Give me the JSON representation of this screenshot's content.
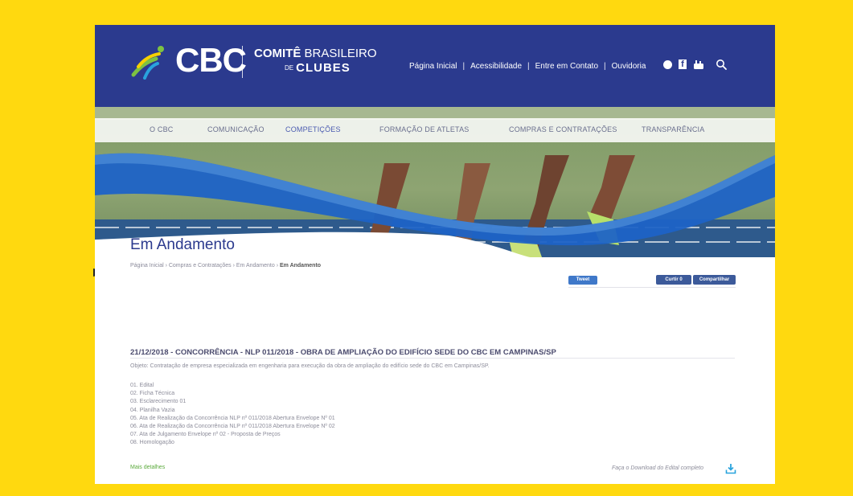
{
  "site": {
    "logo_abbr": "CBC",
    "logo_line1_a": "COMITÊ",
    "logo_line1_b": "BRASILEIRO",
    "logo_line2_a": "DE",
    "logo_line2_b": "CLUBES"
  },
  "header_links": [
    "Página Inicial",
    "Acessibilidade",
    "Entre em Contato",
    "Ouvidoria"
  ],
  "social_icons": [
    "circle-icon",
    "facebook-icon",
    "youtube-icon",
    "search-icon"
  ],
  "nav": [
    "O CBC",
    "COMUNICAÇÃO",
    "COMPETIÇÕES",
    "FORMAÇÃO DE ATLETAS",
    "COMPRAS E CONTRATAÇÕES",
    "TRANSPARÊNCIA"
  ],
  "nav_active_index": 2,
  "page": {
    "title": "Em Andamento",
    "breadcrumb": "Página Inicial › Compras e Contratações › Em Andamento › ",
    "breadcrumb_current": "Em Andamento"
  },
  "share": {
    "tweet": "Tweet",
    "curtir": "Curtir 0",
    "compartilhar": "Compartilhar"
  },
  "article": {
    "title": "21/12/2018 - CONCORRÊNCIA - NLP 011/2018 - OBRA DE AMPLIAÇÃO DO EDIFÍCIO SEDE DO CBC EM CAMPINAS/SP",
    "description": "Objeto: Contratação de empresa especializada em engenharia para execução da obra de ampliação do edifício sede do CBC em Campinas/SP.",
    "documents": [
      "01. Edital",
      "02. Ficha Técnica",
      "03. Esclarecimento 01",
      "04. Planilha Vazia",
      "05. Ata de Realização da Concorrência NLP nº 011/2018 Abertura Envelope Nº 01",
      "06. Ata de Realização da Concorrência NLP nº 011/2018 Abertura Envelope Nº 02",
      "07. Ata de Julgamento Envelope nº 02 - Proposta de Preços",
      "08. Homologação"
    ],
    "more_link": "Mais detalhes",
    "download_label": "Faça o Download do Edital completo"
  },
  "colors": {
    "background": "#FFD90F",
    "header": "#2B3A8E",
    "accent_blue": "#1E63C6",
    "link_green": "#5BAA3C"
  }
}
